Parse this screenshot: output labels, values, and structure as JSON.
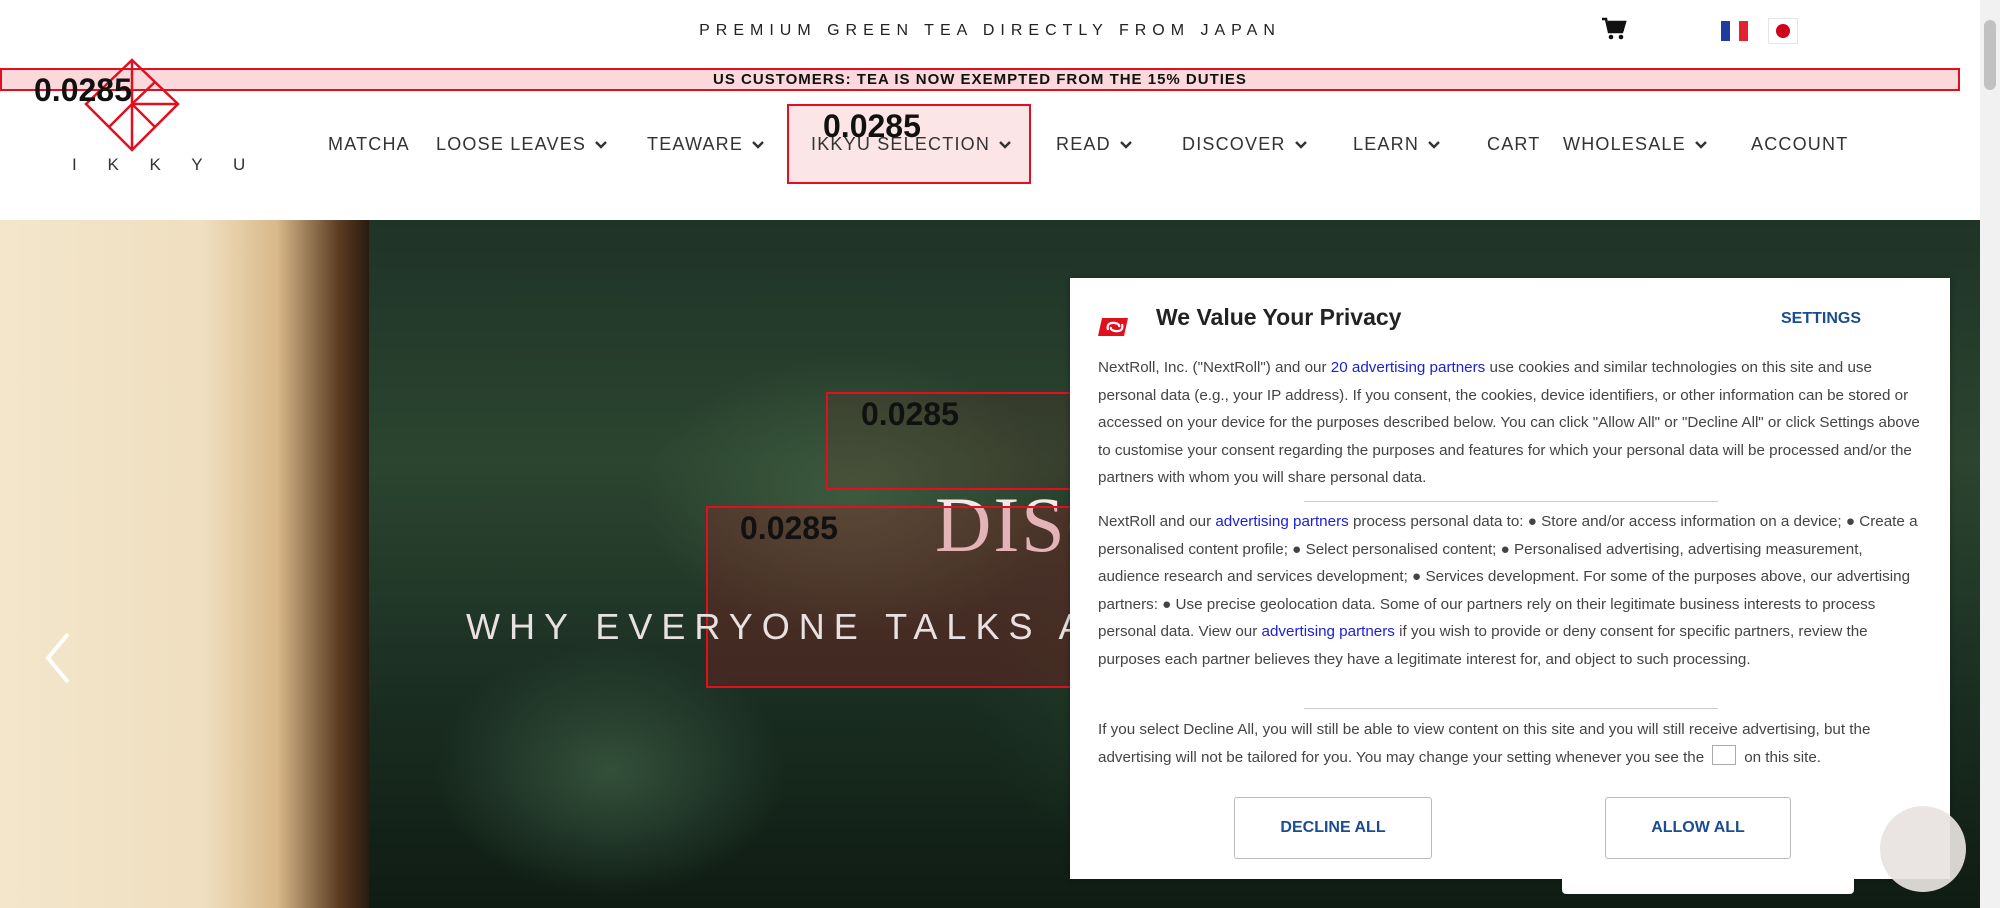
{
  "header": {
    "tagline": "PREMIUM GREEN TEA DIRECTLY FROM JAPAN",
    "announcement": "US CUSTOMERS: TEA IS NOW EXEMPTED FROM THE 15% DUTIES",
    "logo_text": "I K K Y U",
    "icons": [
      "cart-icon",
      "flag-fr-icon",
      "flag-jp-icon"
    ]
  },
  "nav": {
    "items": [
      {
        "label": "MATCHA",
        "dropdown": false
      },
      {
        "label": "LOOSE LEAVES",
        "dropdown": true
      },
      {
        "label": "TEAWARE",
        "dropdown": true
      },
      {
        "label": "IKKYU SELECTION",
        "dropdown": true
      },
      {
        "label": "READ",
        "dropdown": true
      },
      {
        "label": "DISCOVER",
        "dropdown": true
      },
      {
        "label": "LEARN",
        "dropdown": true
      },
      {
        "label": "CART",
        "dropdown": false
      },
      {
        "label": "WHOLESALE",
        "dropdown": true
      },
      {
        "label": "ACCOUNT",
        "dropdown": false
      }
    ]
  },
  "overlay_labels": {
    "logo": "0.0285",
    "nav": "0.0285",
    "hero_box1": "0.0285",
    "hero_box2": "0.0285"
  },
  "hero": {
    "title": "DISC",
    "subtitle": "WHY EVERYONE TALKS AB"
  },
  "consent": {
    "title": "We Value Your Privacy",
    "settings_label": "SETTINGS",
    "p1_before": "NextRoll, Inc. (\"NextRoll\") and our ",
    "p1_link": "20 advertising partners",
    "p1_after": " use cookies and similar technologies on this site and use personal data (e.g., your IP address). If you consent, the cookies, device identifiers, or other information can be stored or accessed on your device for the purposes described below. You can click \"Allow All\" or \"Decline All\" or click Settings above to customise your consent regarding the purposes and features for which your personal data will be processed and/or the partners with whom you will share personal data.",
    "p2_before": "NextRoll and our ",
    "p2_link1": "advertising partners",
    "p2_middle": " process personal data to: ● Store and/or access information on a device; ● Create a personalised content profile; ● Select personalised content; ● Personalised advertising, advertising measurement, audience research and services development; ● Services development. For some of the purposes above, our advertising partners: ● Use precise geolocation data. Some of our partners rely on their legitimate business interests to process personal data. View our ",
    "p2_link2": "advertising partners",
    "p2_after": " if you wish to provide or deny consent for specific partners, review the purposes each partner believes they have a legitimate interest for, and object to such processing.",
    "p3_before": "If you select Decline All, you will still be able to view content on this site and you will still receive advertising, but the advertising will not be tailored for you. You may change your setting whenever you see the",
    "p3_after": "on this site.",
    "decline_label": "DECLINE ALL",
    "allow_label": "ALLOW ALL"
  },
  "colors": {
    "accent_red": "#e0101f",
    "link_blue": "#1a21d8",
    "button_text": "#1a4d8f"
  }
}
